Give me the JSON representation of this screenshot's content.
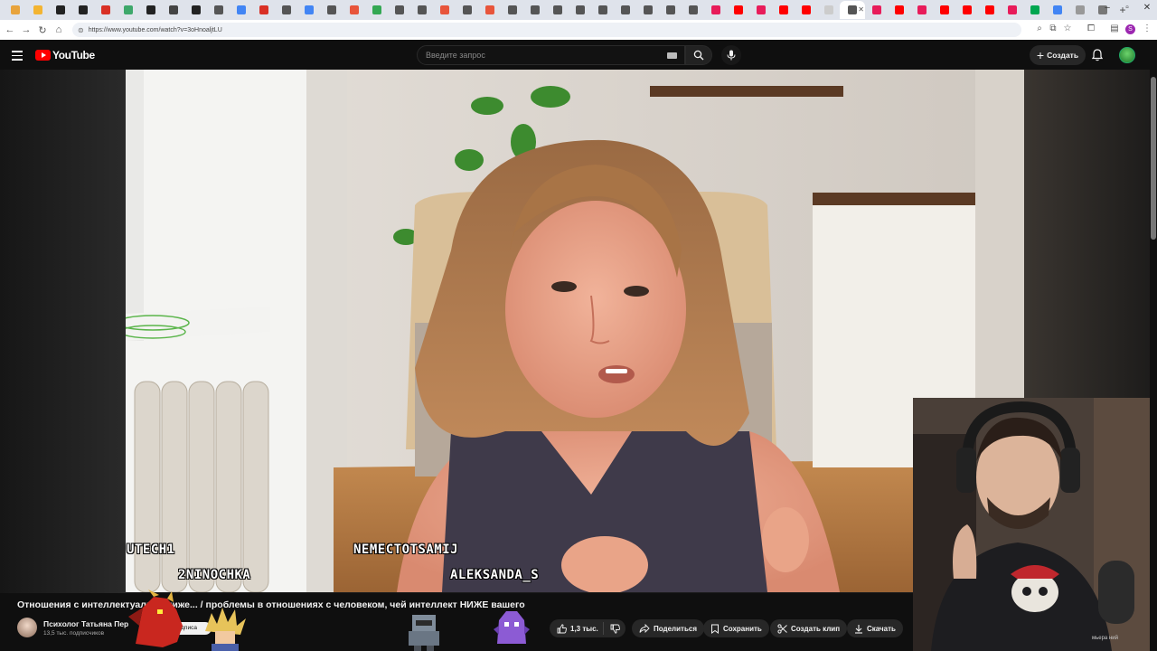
{
  "browser": {
    "url": "https://www.youtube.com/watch?v=3oHnoaljtLU",
    "tab_favicon_colors": [
      "#e8a33c",
      "#f3b431",
      "#222222",
      "#222222",
      "#d93025",
      "#3ea86b",
      "#222222",
      "#444444",
      "#222222",
      "#555555",
      "#4285f4",
      "#d93025",
      "#555555",
      "#4285f4",
      "#555555",
      "#e8553b",
      "#34a853",
      "#555555",
      "#555555",
      "#e8553b",
      "#555555",
      "#e8553b",
      "#555555",
      "#555555",
      "#555555",
      "#555555",
      "#555555",
      "#555555",
      "#555555",
      "#555555",
      "#555555",
      "#e81c5a",
      "#ff0000",
      "#e81c5a",
      "#ff0000",
      "#ff0000",
      "#cccccc",
      "#555555",
      "#e81c5a",
      "#ff0000",
      "#e81c5a",
      "#ff0000",
      "#ff0000",
      "#ff0000",
      "#e81c5a",
      "#00a650",
      "#4285f4",
      "#999999",
      "#777777"
    ]
  },
  "yt": {
    "logo_text": "YouTube",
    "search_placeholder": "Введите запрос",
    "create_label": "Создать",
    "accent": "#ff0000"
  },
  "stream_overlay": {
    "names": [
      "UTECH1",
      "2NINOCHKA",
      "NEMECTOTSAMIJ",
      "ALEKSANDA_S"
    ]
  },
  "video": {
    "title": "Отношения с интеллектуально ниже... / проблемы в отношениях с человеком, чей интеллект НИЖЕ вашего",
    "channel_name": "Психолог Татьяна Пер",
    "subscribers": "13,5 тыс. подписчиков",
    "subscribe_label": "Подписа",
    "likes": "1,3 тыс.",
    "share_label": "Поделиться",
    "save_label": "Сохранить",
    "clip_label": "Создать клип",
    "download_label": "Скачать"
  },
  "webcam": {
    "corner_text": "мьера ний"
  }
}
